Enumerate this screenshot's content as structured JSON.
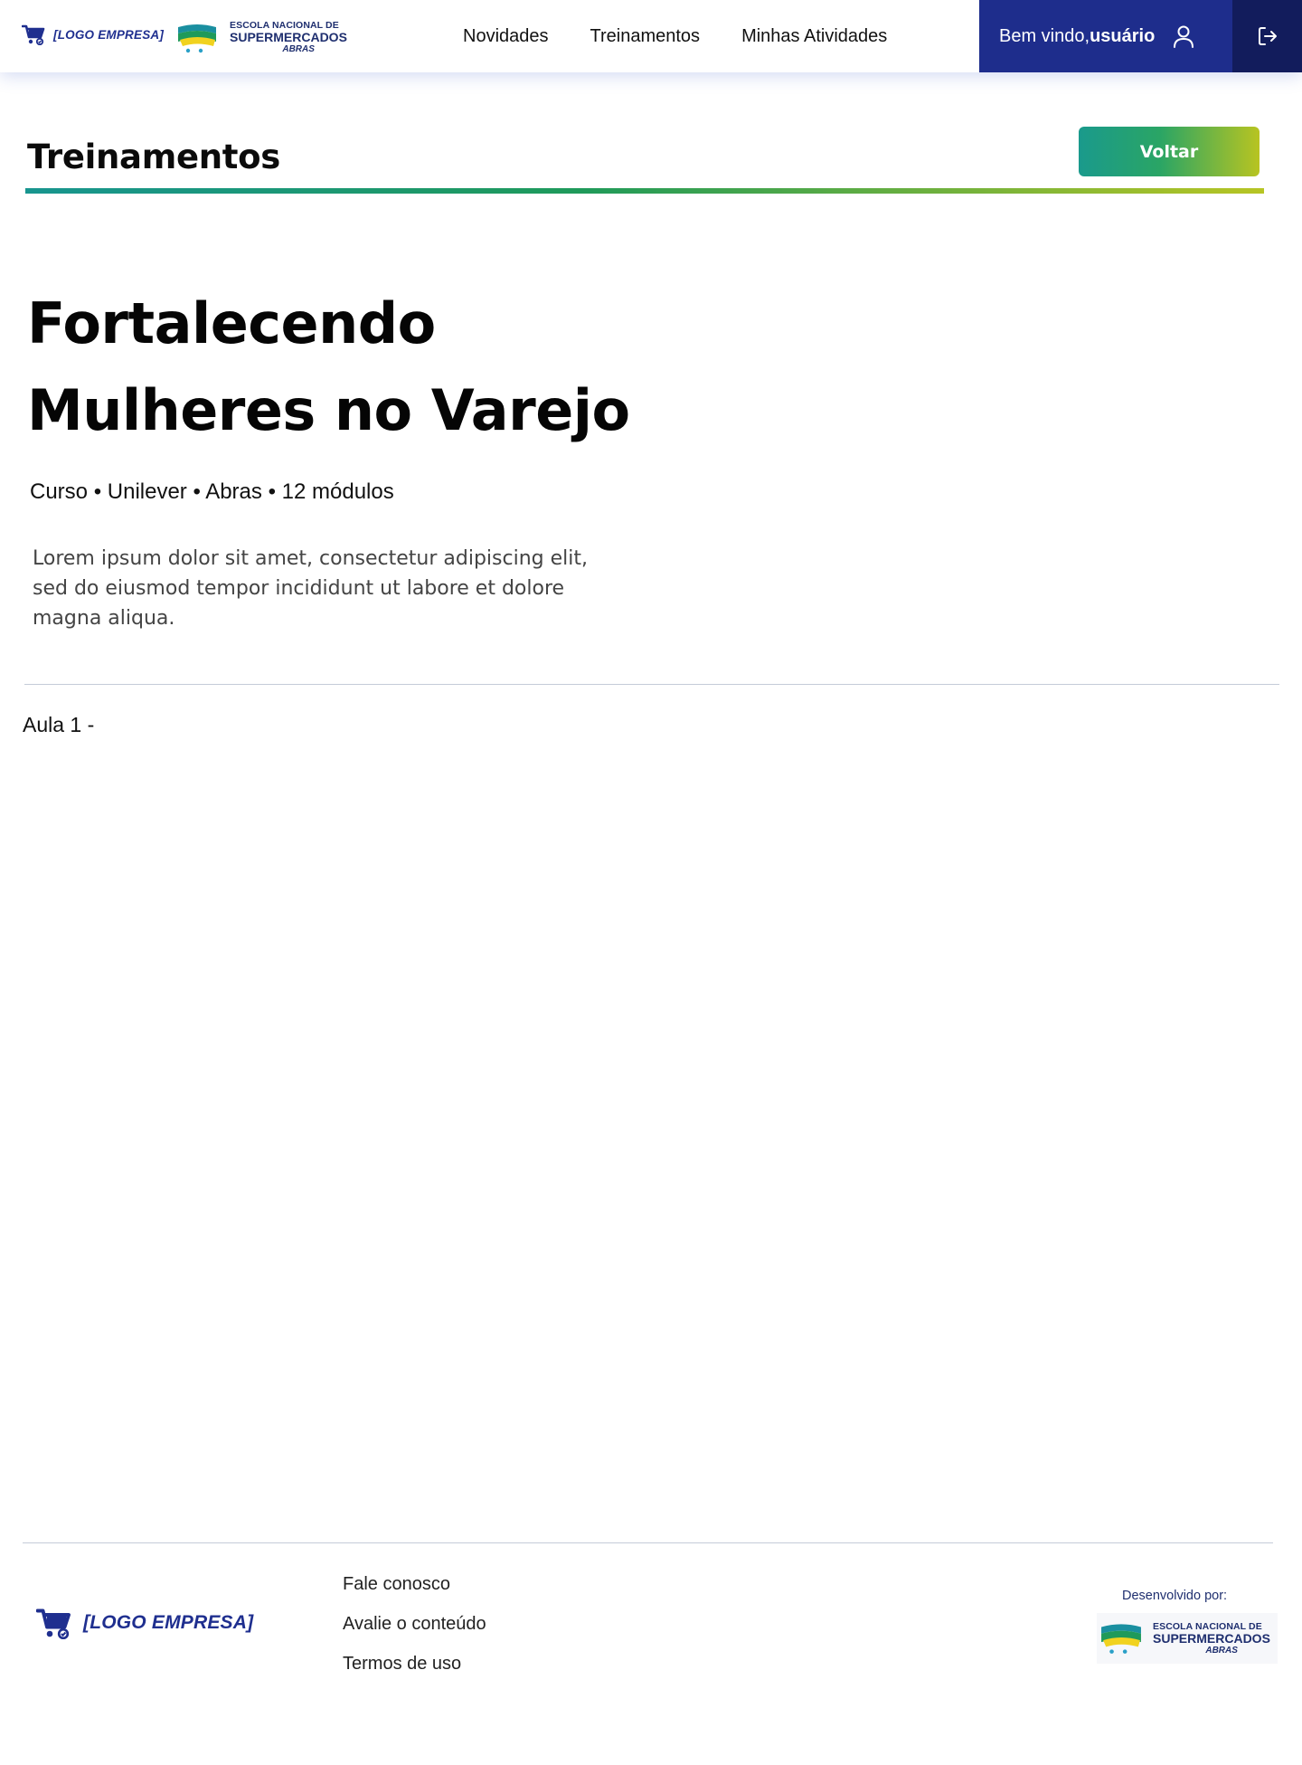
{
  "header": {
    "company_logo_text": "[LOGO EMPRESA]",
    "school_logo": {
      "line1": "ESCOLA NACIONAL DE",
      "line2": "SUPERMERCADOS",
      "line3": "ABRAS"
    },
    "nav": [
      {
        "label": "Novidades"
      },
      {
        "label": "Treinamentos"
      },
      {
        "label": "Minhas Atividades"
      }
    ],
    "welcome_text": "Bem vindo,",
    "user_name": "usuário",
    "icons": {
      "user": "user-icon",
      "logout": "logout-icon",
      "cart": "cart-icon"
    }
  },
  "section": {
    "title": "Treinamentos",
    "back_button": "Voltar"
  },
  "course": {
    "title": "Fortalecendo Mulheres no Varejo",
    "meta": "Curso • Unilever • Abras • 12 módulos",
    "description": "Lorem ipsum dolor sit amet, consectetur adipiscing elit, sed do eiusmod tempor incididunt ut labore et dolore magna aliqua.",
    "lesson_label": "Aula 1 -"
  },
  "footer": {
    "company_logo_text": "[LOGO EMPRESA]",
    "links": [
      {
        "label": "Fale conosco"
      },
      {
        "label": "Avalie o conteúdo"
      },
      {
        "label": "Termos de uso"
      }
    ],
    "developed_by": "Desenvolvido por:",
    "school_logo": {
      "line1": "ESCOLA NACIONAL DE",
      "line2": "SUPERMERCADOS",
      "line3": "ABRAS"
    }
  },
  "colors": {
    "brand_blue": "#1e2d8c",
    "brand_navy": "#121c5c",
    "gradient_start": "#18958f",
    "gradient_mid": "#1f9a5a",
    "gradient_end": "#b7c524",
    "logo_text": "#1f2f8f"
  }
}
